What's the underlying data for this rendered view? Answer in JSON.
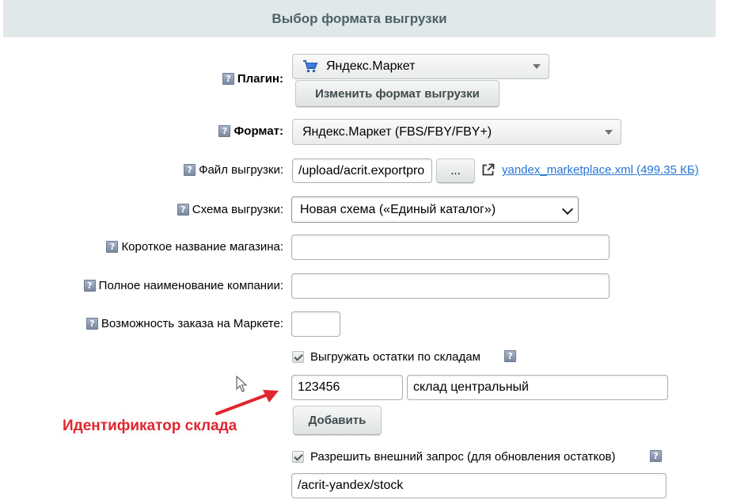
{
  "header": {
    "title": "Выбор формата выгрузки"
  },
  "plugin": {
    "label": "Плагин:",
    "value": "Яндекс.Маркет",
    "change_button": "Изменить формат выгрузки"
  },
  "format": {
    "label": "Формат:",
    "value": "Яндекс.Маркет (FBS/FBY/FBY+)"
  },
  "file": {
    "label": "Файл выгрузки:",
    "value": "/upload/acrit.exportpro",
    "browse_button": "...",
    "link_text": "yandex_marketplace.xml (499.35 КБ)"
  },
  "schema": {
    "label": "Схема выгрузки:",
    "value": "Новая схема («Единый каталог»)"
  },
  "short_name": {
    "label": "Короткое название магазина:",
    "value": ""
  },
  "company_name": {
    "label": "Полное наименование компании:",
    "value": ""
  },
  "order_possibility": {
    "label": "Возможность заказа на Маркете:",
    "value": ""
  },
  "stocks": {
    "checkbox_label": "Выгружать остатки по складам",
    "warehouse_id": "123456",
    "warehouse_name": "склад центральный",
    "add_button": "Добавить"
  },
  "external_request": {
    "checkbox_label": "Разрешить внешний запрос (для обновления остатков)",
    "url": "/acrit-yandex/stock"
  },
  "annotation": {
    "text": "Идентификатор склада",
    "color": "#e0262f"
  },
  "help_glyph": "?"
}
